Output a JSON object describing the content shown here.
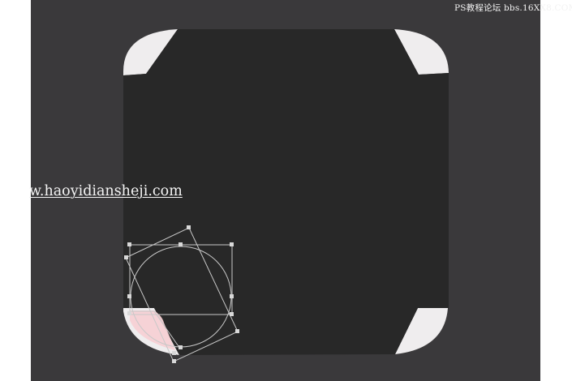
{
  "watermarks": {
    "source": "PS教程论坛 bbs.16XX8.COM",
    "site": "w.haoyidiansheji.com"
  },
  "artwork": {
    "icon_description": "rounded square icon with folded page corners",
    "corners": [
      "top-left",
      "top-right",
      "bottom-left",
      "bottom-right"
    ]
  },
  "colors": {
    "canvas_background": "#3a393b",
    "icon_fill": "#282828",
    "corner_fold": "#efedee",
    "selected_fold": "#f6d1d4",
    "transform_handles": "#c8c8c8"
  }
}
